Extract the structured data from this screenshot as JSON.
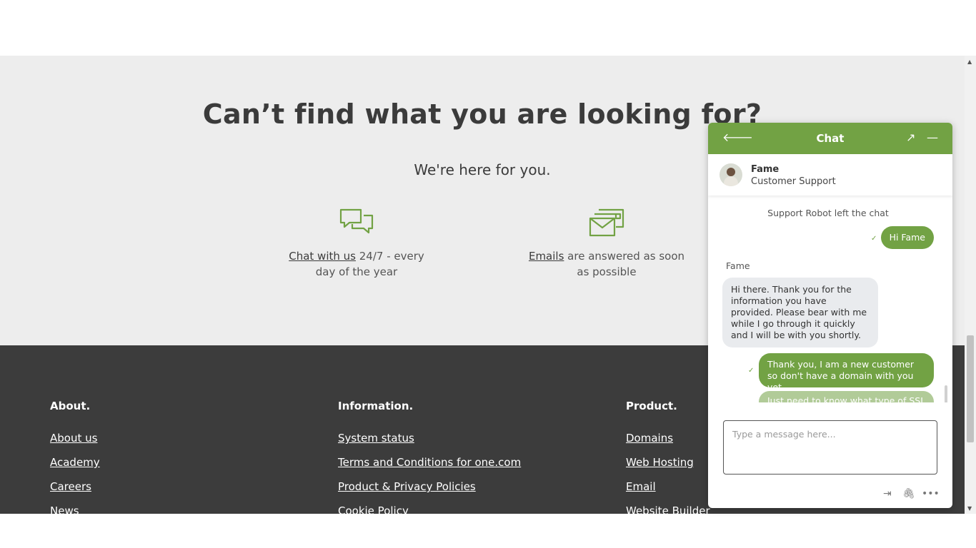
{
  "help": {
    "title": "Can’t find what you are looking for?",
    "subtitle": "We're here for you.",
    "chat": {
      "link": "Chat with us",
      "text": " 24/7 - every day of the year",
      "icon": "chat-bubbles-icon"
    },
    "email": {
      "link": "Emails",
      "text": " are answered as soon as possible",
      "icon": "email-icon"
    }
  },
  "footer": {
    "about": {
      "heading": "About.",
      "links": [
        "About us",
        "Academy",
        "Careers",
        "News"
      ]
    },
    "information": {
      "heading": "Information.",
      "links": [
        "System status",
        "Terms and Conditions for one.com",
        "Product & Privacy Policies",
        "Cookie Policy"
      ]
    },
    "product": {
      "heading": "Product.",
      "links": [
        "Domains",
        "Web Hosting",
        "Email",
        "Website Builder"
      ]
    }
  },
  "chat": {
    "title": "Chat",
    "agent_name": "Fame",
    "agent_role": "Customer Support",
    "system_message": "Support Robot left the chat",
    "messages": {
      "out1": "Hi Fame",
      "sender": "Fame",
      "in1": "Hi there. Thank you for the information you have provided. Please bear with me while I go through it quickly and I will be with you shortly.",
      "out2": "Thank you, I am a new customer so don't have a domain with you yet",
      "out3": "Just need to know what type of SSL"
    },
    "input_placeholder": "Type a message here..."
  },
  "colors": {
    "brand_green": "#72a244",
    "footer_bg": "#3c3c3c",
    "section_bg": "#ededed"
  }
}
